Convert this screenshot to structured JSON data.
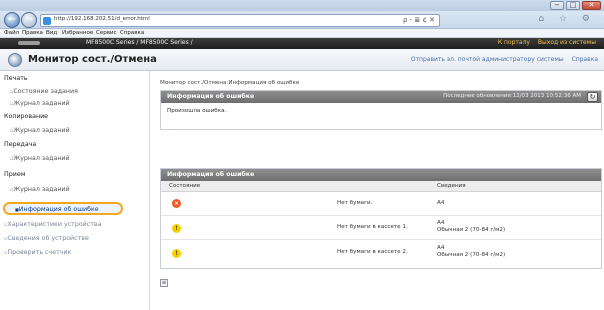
{
  "browser": {
    "url": "http://192.168.202.51/d_error.html",
    "address_tools": "ρ - ≣ ¢ ✕",
    "toolbar_icons": "⌂ ☆ ⚙",
    "window_buttons": [
      "−",
      "□",
      "✕"
    ]
  },
  "menu": [
    "Файл",
    "Правка",
    "Вид",
    "Избранное",
    "Сервис",
    "Справка"
  ],
  "device": {
    "title": "MF8500C Series / MF8500C Series /",
    "right_links": [
      "К порталу",
      "Выход из системы"
    ]
  },
  "page": {
    "title": "Монитор сост./Отмена",
    "right_links": [
      "Отправить эл. почтой администратору системы",
      "Справка"
    ]
  },
  "sidebar": {
    "sections": [
      {
        "label": "Печать",
        "items": [
          "Состояние задания",
          "Журнал заданий"
        ]
      },
      {
        "label": "Копирование",
        "items": [
          "Журнал заданий"
        ]
      },
      {
        "label": "Передача",
        "items": [
          "Журнал заданий"
        ]
      },
      {
        "label": "Прием",
        "items": [
          "Журнал заданий"
        ]
      }
    ],
    "active_item": "Информация об ошибке",
    "trailing_items": [
      "Характеристики устройства",
      "Сведения об устройстве",
      "Проверить счетчик"
    ]
  },
  "main": {
    "breadcrumb": "Монитор сост./Отмена:Информация об ошибке",
    "summary_panel": {
      "title": "Информация об ошибке",
      "updated": "Последнее обновление:12/03 2013 10:52:36 AM",
      "message": "Произошла ошибка."
    },
    "table_panel": {
      "title": "Информация об ошибке",
      "columns": [
        "Состояние",
        "Сведения"
      ],
      "rows": [
        {
          "status": "error",
          "message": "Нет бумаги.",
          "details": [
            "A4"
          ]
        },
        {
          "status": "warning",
          "message": "Нет бумаги в кассете 1.",
          "details": [
            "A4",
            "Обычная 2 (70-84 г/м2)"
          ]
        },
        {
          "status": "warning",
          "message": "Нет бумаги в кассете 2.",
          "details": [
            "A4",
            "Обычная 2 (70-84 г/м2)"
          ]
        }
      ]
    }
  },
  "colors": {
    "accent": "#f5a623",
    "link": "#4a73a8",
    "error": "#ea5a2a",
    "warning": "#f4d000"
  }
}
